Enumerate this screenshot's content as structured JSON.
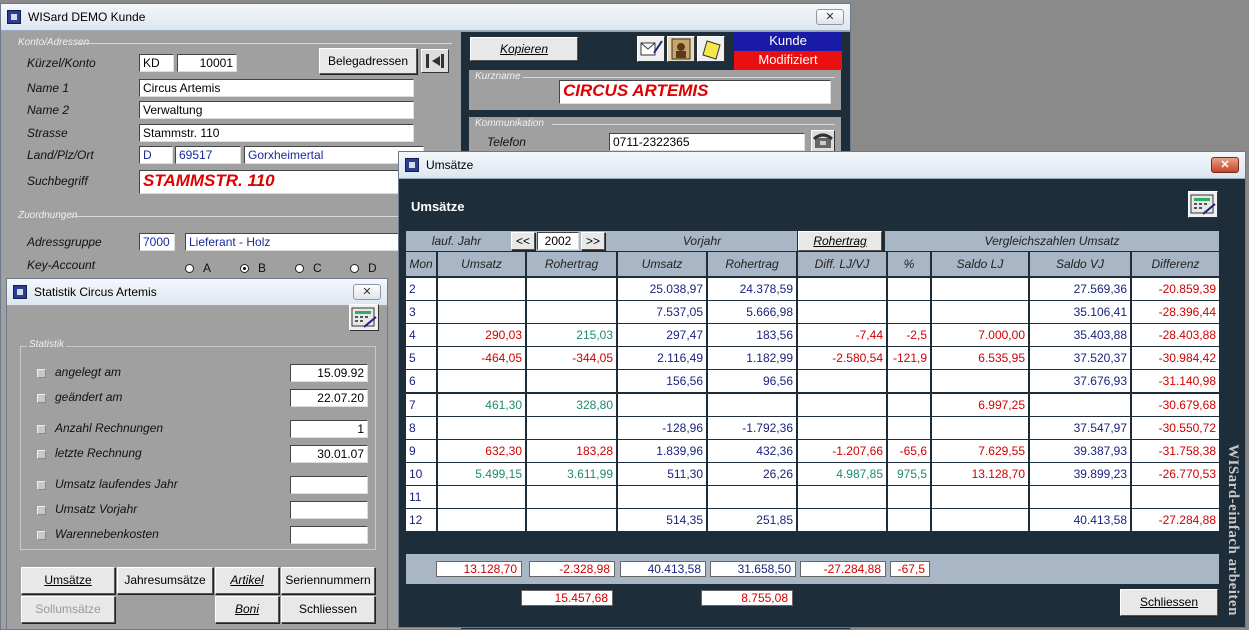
{
  "main_window": {
    "title": "WISard DEMO Kunde",
    "close": "✕",
    "sections": {
      "address": "Konto/Adressen",
      "assignment": "Zuordnungen",
      "short_name": "Kurzname",
      "communication": "Kommunikation"
    },
    "labels": {
      "kuerzel": "Kürzel/Konto",
      "name1": "Name 1",
      "name2": "Name 2",
      "strasse": "Strasse",
      "land": "Land/Plz/Ort",
      "such": "Suchbegriff",
      "adressgruppe": "Adressgruppe",
      "key_account": "Key-Account",
      "telefon": "Telefon"
    },
    "values": {
      "kuerzel": "KD",
      "konto": "10001",
      "name1": "Circus Artemis",
      "name2": "Verwaltung",
      "strasse": "Stammstr. 110",
      "land": "D",
      "plz": "69517",
      "ort": "Gorxheimertal",
      "such": "STAMMSTR. 110",
      "adressgruppe_code": "7000",
      "adressgruppe_name": "Lieferant - Holz",
      "kurzname": "CIRCUS ARTEMIS",
      "telefon": "0711-2322365"
    },
    "key_account_options": [
      "A",
      "B",
      "C",
      "D"
    ],
    "key_account_selected": "B",
    "buttons": {
      "belegadressen": "Belegadressen",
      "kopieren": "Kopieren"
    },
    "status": {
      "kunde": "Kunde",
      "modifiziert": "Modifiziert"
    },
    "colors": {
      "status_blue": "#1a1aa8",
      "status_red": "#e81010"
    }
  },
  "stat_window": {
    "title": "Statistik Circus Artemis",
    "close": "✕",
    "section": "Statistik",
    "rows": [
      {
        "label": "angelegt am",
        "value": "15.09.92"
      },
      {
        "label": "geändert am",
        "value": "22.07.20"
      },
      {
        "label": "Anzahl Rechnungen",
        "value": "1"
      },
      {
        "label": "letzte Rechnung",
        "value": "30.01.07"
      },
      {
        "label": "Umsatz laufendes Jahr",
        "value": ""
      },
      {
        "label": "Umsatz Vorjahr",
        "value": ""
      },
      {
        "label": "Warennebenkosten",
        "value": ""
      }
    ],
    "buttons": {
      "umsaetze": "Umsätze",
      "jahresumsaetze": "Jahresumsätze",
      "artikel": "Artikel",
      "seriennummern": "Seriennummern",
      "sollumsaetze": "Sollumsätze",
      "boni": "Boni",
      "schliessen": "Schliessen"
    }
  },
  "umsatz_window": {
    "title": "Umsätze",
    "close": "✕",
    "heading": "Umsätze",
    "group_headers": {
      "lauf_jahr": "lauf. Jahr",
      "prev": "<<",
      "year": "2002",
      "next": ">>",
      "vorjahr": "Vorjahr",
      "rohertrag_btn": "Rohertrag",
      "vergleich": "Vergleichszahlen Umsatz"
    },
    "columns": [
      "Mon",
      "Umsatz",
      "Rohertrag",
      "Umsatz",
      "Rohertrag",
      "Diff. LJ/VJ",
      "%",
      "Saldo LJ",
      "Saldo VJ",
      "Differenz"
    ],
    "rows": [
      {
        "mon": "2",
        "c": [
          "",
          "",
          "25.038,97",
          "24.378,59",
          "",
          "",
          "",
          "27.569,36",
          "-20.859,39"
        ]
      },
      {
        "mon": "3",
        "c": [
          "",
          "",
          "7.537,05",
          "5.666,98",
          "",
          "",
          "",
          "35.106,41",
          "-28.396,44"
        ]
      },
      {
        "mon": "4",
        "c": [
          "290,03",
          "215,03",
          "297,47",
          "183,56",
          "-7,44",
          "-2,5",
          "7.000,00",
          "35.403,88",
          "-28.403,88"
        ]
      },
      {
        "mon": "5",
        "c": [
          "-464,05",
          "-344,05",
          "2.116,49",
          "1.182,99",
          "-2.580,54",
          "-121,9",
          "6.535,95",
          "37.520,37",
          "-30.984,42"
        ]
      },
      {
        "mon": "6",
        "c": [
          "",
          "",
          "156,56",
          "96,56",
          "",
          "",
          "",
          "37.676,93",
          "-31.140,98"
        ]
      },
      {
        "mon": "7",
        "c": [
          "461,30",
          "328,80",
          "",
          "",
          "",
          "",
          "6.997,25",
          "",
          "-30.679,68"
        ]
      },
      {
        "mon": "8",
        "c": [
          "",
          "",
          "-128,96",
          "-1.792,36",
          "",
          "",
          "",
          "37.547,97",
          "-30.550,72"
        ]
      },
      {
        "mon": "9",
        "c": [
          "632,30",
          "183,28",
          "1.839,96",
          "432,36",
          "-1.207,66",
          "-65,6",
          "7.629,55",
          "39.387,93",
          "-31.758,38"
        ]
      },
      {
        "mon": "10",
        "c": [
          "5.499,15",
          "3.611,99",
          "511,30",
          "26,26",
          "4.987,85",
          "975,5",
          "13.128,70",
          "39.899,23",
          "-26.770,53"
        ]
      },
      {
        "mon": "11",
        "c": [
          "",
          "",
          "",
          "",
          "",
          "",
          "",
          "",
          ""
        ]
      },
      {
        "mon": "12",
        "c": [
          "",
          "",
          "514,35",
          "251,85",
          "",
          "",
          "",
          "40.413,58",
          "-27.284,88"
        ]
      }
    ],
    "totals": [
      "13.128,70",
      "-2.328,98",
      "40.413,58",
      "31.658,50",
      "-27.284,88",
      "-67,5"
    ],
    "totals2": [
      "15.457,68",
      "8.755,08"
    ],
    "close_button": "Schliessen",
    "side_text": "WISard-einfach arbeiten"
  }
}
